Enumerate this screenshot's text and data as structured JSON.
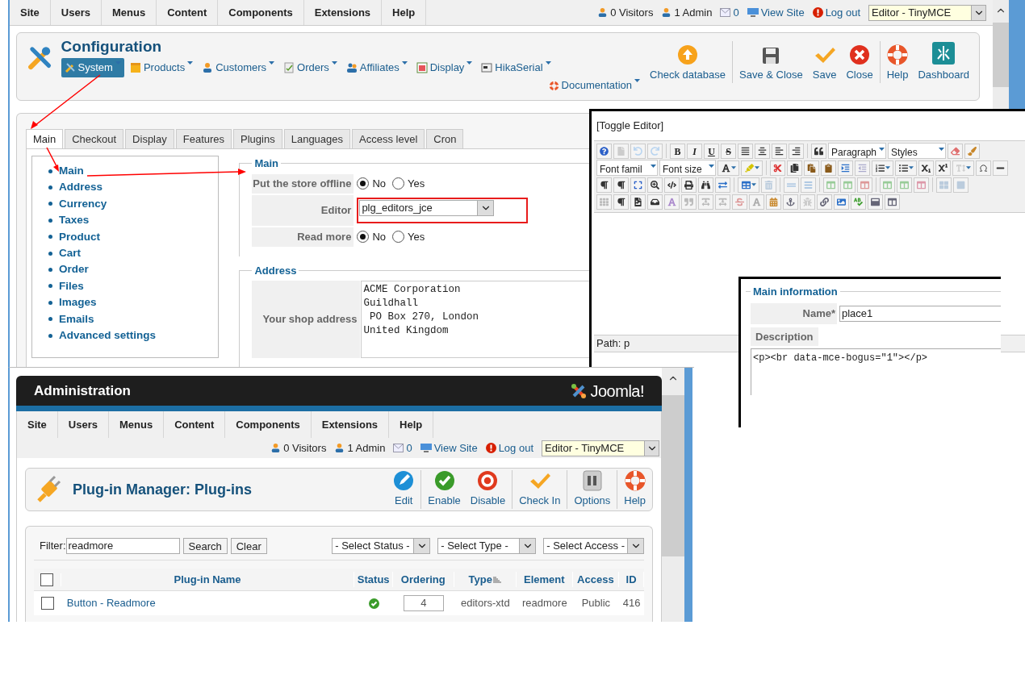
{
  "config_window": {
    "menu": [
      "Site",
      "Users",
      "Menus",
      "Content",
      "Components",
      "Extensions",
      "Help"
    ],
    "status": {
      "visitors": "0 Visitors",
      "admins": "1 Admin",
      "messages": "0",
      "view_site": "View Site",
      "logout": "Log out",
      "editor_select": "Editor - TinyMCE"
    },
    "title": "Configuration",
    "submenu": [
      {
        "label": "System",
        "kind": "tools",
        "selected": true
      },
      {
        "label": "Products",
        "kind": "box",
        "selected": false
      },
      {
        "label": "Customers",
        "kind": "user",
        "selected": false
      },
      {
        "label": "Orders",
        "kind": "document",
        "selected": false
      },
      {
        "label": "Affiliates",
        "kind": "users",
        "selected": false
      },
      {
        "label": "Display",
        "kind": "window",
        "selected": false
      },
      {
        "label": "HikaSerial",
        "kind": "card",
        "selected": false
      },
      {
        "label": "Documentation",
        "kind": "lifebuoy",
        "selected": false
      }
    ],
    "toolbar": [
      [
        {
          "label": "Check database",
          "kind": "upload"
        }
      ],
      [
        {
          "label": "Save & Close",
          "kind": "save"
        },
        {
          "label": "Save",
          "kind": "check"
        },
        {
          "label": "Close",
          "kind": "close"
        }
      ],
      [
        {
          "label": "Help",
          "kind": "help"
        },
        {
          "label": "Dashboard",
          "kind": "dashboard"
        }
      ]
    ],
    "tabs": [
      {
        "label": "Main",
        "selected": true
      },
      {
        "label": "Checkout",
        "selected": false
      },
      {
        "label": "Display",
        "selected": false
      },
      {
        "label": "Features",
        "selected": false
      },
      {
        "label": "Plugins",
        "selected": false
      },
      {
        "label": "Languages",
        "selected": false
      },
      {
        "label": "Access level",
        "selected": false
      },
      {
        "label": "Cron",
        "selected": false
      }
    ],
    "sections": [
      "Main",
      "Address",
      "Currency",
      "Taxes",
      "Product",
      "Cart",
      "Order",
      "Files",
      "Images",
      "Emails",
      "Advanced settings"
    ],
    "main_fieldset": {
      "legend": "Main",
      "rows": [
        {
          "label": "Put the store offline",
          "kind": "radio",
          "options": [
            {
              "label": "No",
              "selected": true
            },
            {
              "label": "Yes",
              "selected": false
            }
          ]
        },
        {
          "label": "Editor",
          "kind": "select",
          "value": "plg_editors_jce"
        },
        {
          "label": "Read more",
          "kind": "radio",
          "options": [
            {
              "label": "No",
              "selected": true
            },
            {
              "label": "Yes",
              "selected": false
            }
          ]
        }
      ]
    },
    "address_fieldset": {
      "legend": "Address",
      "label": "Your shop address",
      "value": "ACME Corporation\nGuildhall\n PO Box 270, London\nUnited Kingdom"
    }
  },
  "editor_window": {
    "toggle": "[Toggle Editor]",
    "format_buttons": [
      "B",
      "I",
      "U",
      "S"
    ],
    "dropdowns": [
      "Paragraph",
      "Styles",
      "Font famil",
      "Font size"
    ],
    "path": "Path: p"
  },
  "info_window": {
    "legend": "Main information",
    "name_label": "Name*",
    "name_value": "place1",
    "description_label": "Description",
    "description_value": "<p><br data-mce-bogus=\"1\"></p>"
  },
  "admin_window": {
    "header": "Administration",
    "logo_text": "Joomla!",
    "menu": [
      "Site",
      "Users",
      "Menus",
      "Content",
      "Components",
      "Extensions",
      "Help"
    ],
    "status": {
      "visitors": "0 Visitors",
      "admins": "1 Admin",
      "messages": "0",
      "view_site": "View Site",
      "logout": "Log out",
      "editor_select": "Editor - TinyMCE"
    },
    "title": "Plug-in Manager: Plug-ins",
    "toolbar": [
      [
        {
          "label": "Edit",
          "kind": "edit"
        }
      ],
      [
        {
          "label": "Enable",
          "kind": "enable"
        },
        {
          "label": "Disable",
          "kind": "disable"
        }
      ],
      [
        {
          "label": "Check In",
          "kind": "check"
        }
      ],
      [
        {
          "label": "Options",
          "kind": "options"
        }
      ],
      [
        {
          "label": "Help",
          "kind": "help"
        }
      ]
    ],
    "filter": {
      "label": "Filter:",
      "value": "readmore",
      "buttons": [
        "Search",
        "Clear"
      ],
      "selects": [
        "- Select Status -",
        "- Select Type -",
        "- Select Access -"
      ]
    },
    "table": {
      "select_all_checked": false,
      "columns": [
        "Plug-in Name",
        "Status",
        "Ordering",
        "Type",
        "Element",
        "Access",
        "ID"
      ],
      "rows": [
        {
          "checked": false,
          "name": "Button - Readmore",
          "enabled": true,
          "ordering": "4",
          "type": "editors-xtd",
          "element": "readmore",
          "access": "Public",
          "id": "416"
        }
      ]
    }
  }
}
